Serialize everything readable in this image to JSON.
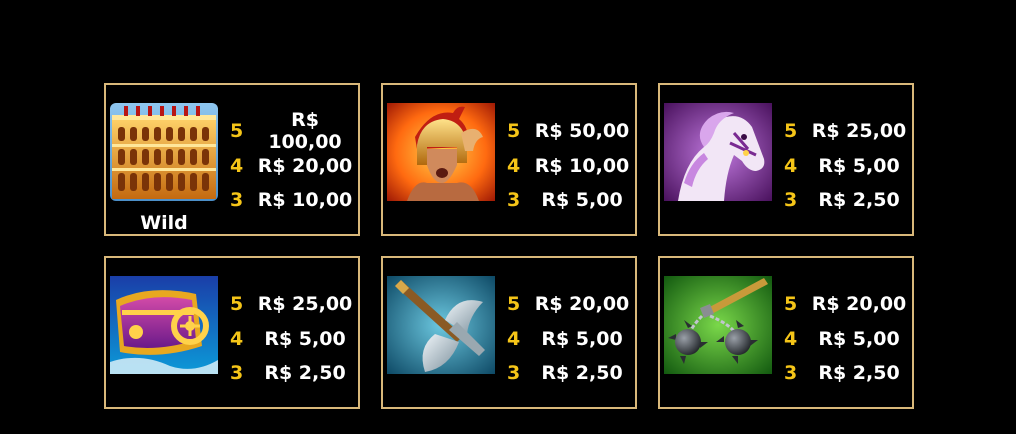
{
  "cards": [
    {
      "symbol": "colosseum-wild",
      "label": "Wild",
      "pays": [
        {
          "count": "5",
          "amount": "R$ 100,00"
        },
        {
          "count": "4",
          "amount": "R$ 20,00"
        },
        {
          "count": "3",
          "amount": "R$ 10,00"
        }
      ]
    },
    {
      "symbol": "gladiator-helmet",
      "pays": [
        {
          "count": "5",
          "amount": "R$ 50,00"
        },
        {
          "count": "4",
          "amount": "R$ 10,00"
        },
        {
          "count": "3",
          "amount": "R$ 5,00"
        }
      ]
    },
    {
      "symbol": "white-horse",
      "pays": [
        {
          "count": "5",
          "amount": "R$ 25,00"
        },
        {
          "count": "4",
          "amount": "R$ 5,00"
        },
        {
          "count": "3",
          "amount": "R$ 2,50"
        }
      ]
    },
    {
      "symbol": "chariot",
      "pays": [
        {
          "count": "5",
          "amount": "R$ 25,00"
        },
        {
          "count": "4",
          "amount": "R$ 5,00"
        },
        {
          "count": "3",
          "amount": "R$ 2,50"
        }
      ]
    },
    {
      "symbol": "battle-axe",
      "pays": [
        {
          "count": "5",
          "amount": "R$ 20,00"
        },
        {
          "count": "4",
          "amount": "R$ 5,00"
        },
        {
          "count": "3",
          "amount": "R$ 2,50"
        }
      ]
    },
    {
      "symbol": "flail",
      "pays": [
        {
          "count": "5",
          "amount": "R$ 20,00"
        },
        {
          "count": "4",
          "amount": "R$ 5,00"
        },
        {
          "count": "3",
          "amount": "R$ 2,50"
        }
      ]
    }
  ],
  "colors": {
    "background": "#000000",
    "card_border": "#d9b87a",
    "count": "#f5c518",
    "amount": "#ffffff"
  }
}
